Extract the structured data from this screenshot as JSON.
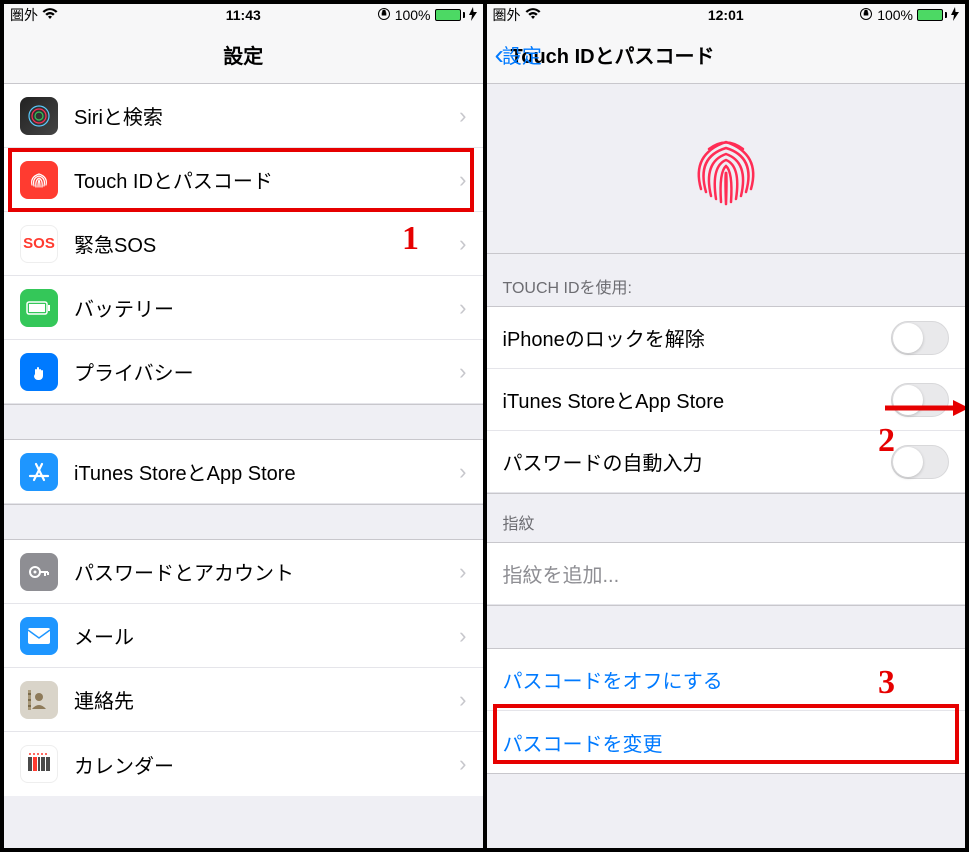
{
  "left": {
    "status": {
      "carrier": "圏外",
      "time": "11:43",
      "battery": "100%"
    },
    "title": "設定",
    "rows": [
      {
        "label": "Siriと検索"
      },
      {
        "label": "Touch IDとパスコード"
      },
      {
        "label": "緊急SOS"
      },
      {
        "label": "バッテリー"
      },
      {
        "label": "プライバシー"
      },
      {
        "label": "iTunes StoreとApp Store"
      },
      {
        "label": "パスワードとアカウント"
      },
      {
        "label": "メール"
      },
      {
        "label": "連絡先"
      },
      {
        "label": "カレンダー"
      }
    ],
    "annotation1": "1"
  },
  "right": {
    "status": {
      "carrier": "圏外",
      "time": "12:01",
      "battery": "100%"
    },
    "back": "設定",
    "title": "Touch IDとパスコード",
    "section_touchid": "TOUCH IDを使用:",
    "toggles": [
      {
        "label": "iPhoneのロックを解除"
      },
      {
        "label": "iTunes StoreとApp Store"
      },
      {
        "label": "パスワードの自動入力"
      }
    ],
    "section_finger": "指紋",
    "add_finger": "指紋を追加...",
    "passcode_off": "パスコードをオフにする",
    "passcode_change": "パスコードを変更",
    "annotation2": "2",
    "annotation3": "3"
  },
  "icons": {
    "sos_text": "SOS"
  }
}
